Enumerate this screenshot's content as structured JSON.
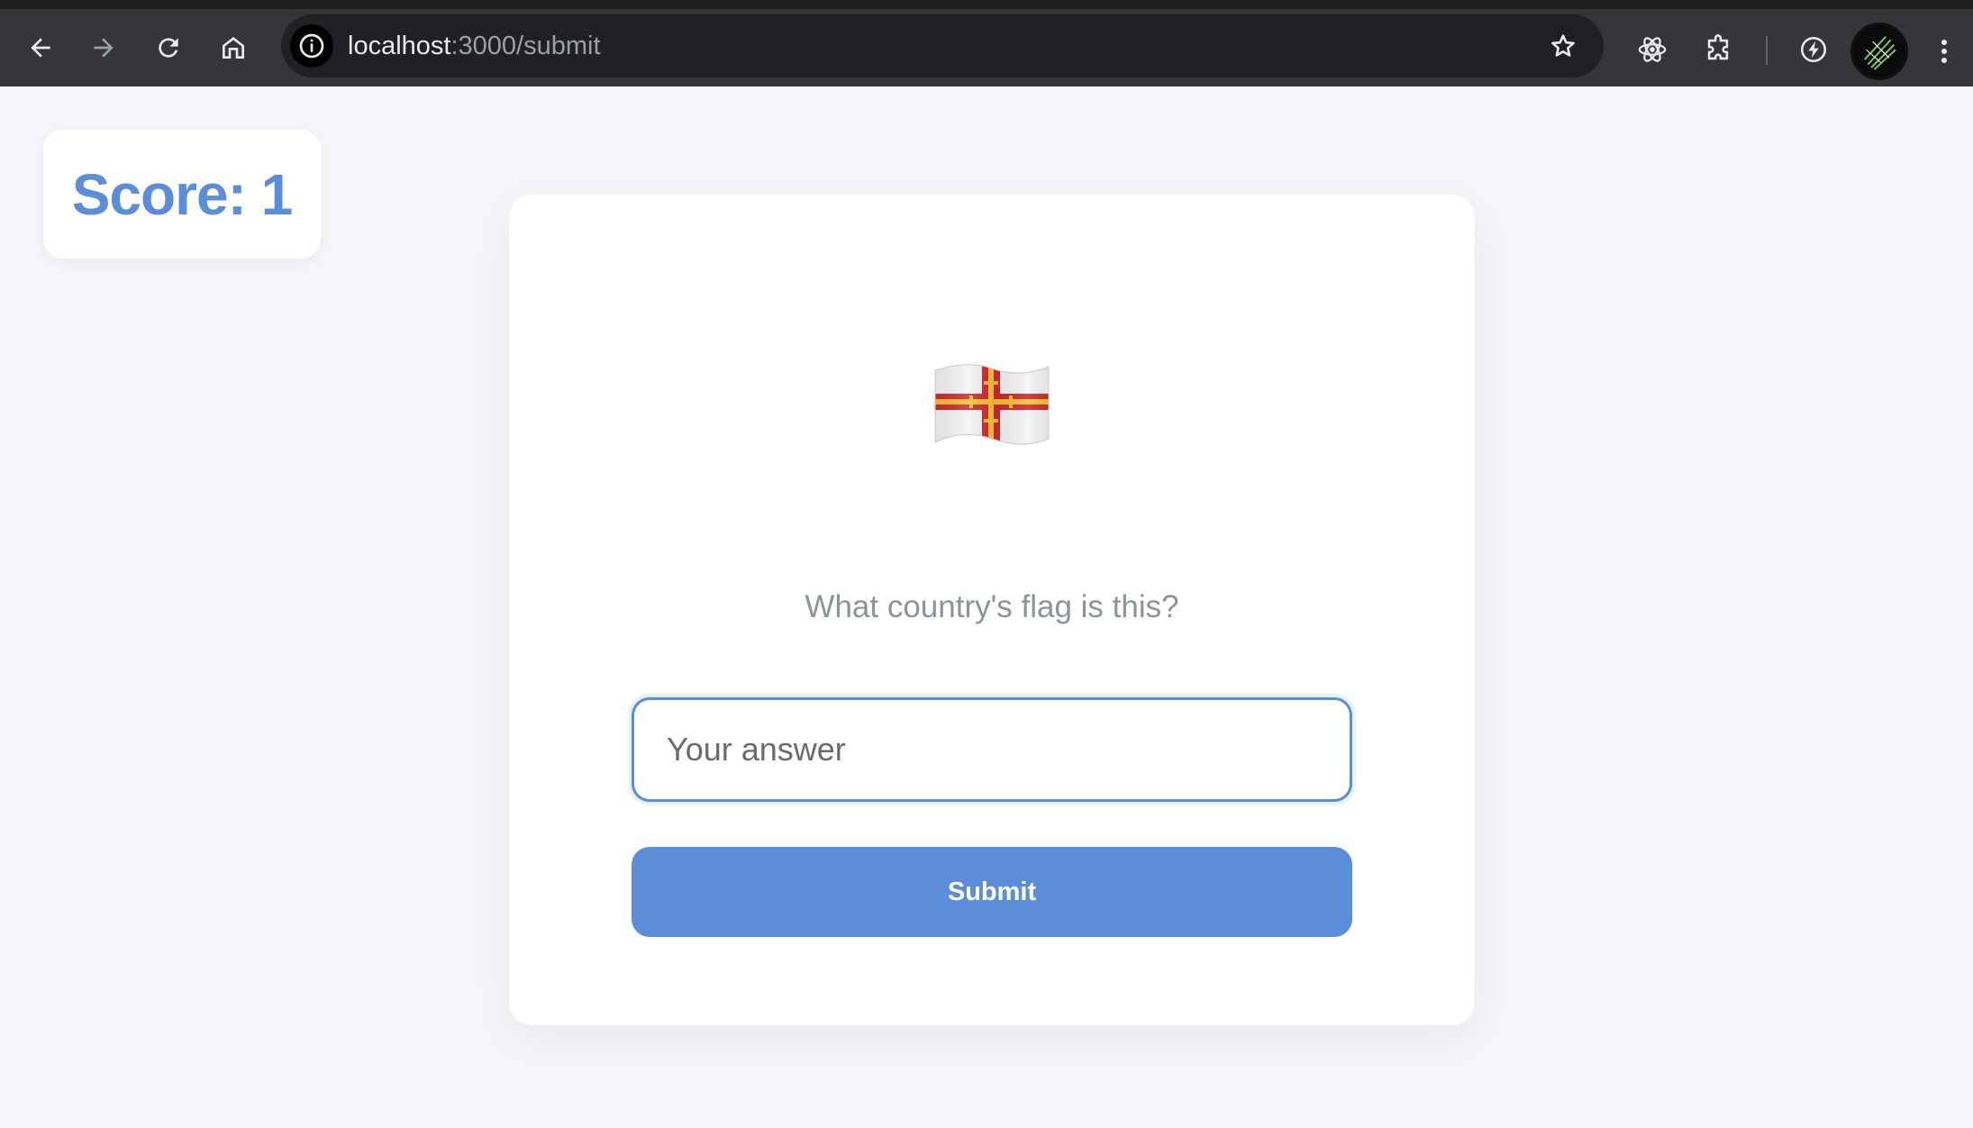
{
  "browser": {
    "url_host": "localhost",
    "url_path": ":3000/submit",
    "icons": {
      "back": "back-arrow-icon",
      "forward": "forward-arrow-icon",
      "reload": "reload-icon",
      "home": "home-icon",
      "site_info": "info-icon",
      "bookmark": "star-icon",
      "ext_react": "react-atom-icon",
      "ext_puzzle": "extensions-puzzle-icon",
      "ext_bolt": "lightning-bolt-icon",
      "menu": "kebab-menu-icon"
    }
  },
  "score": {
    "text": "Score: 1"
  },
  "quiz": {
    "flag_emoji_name": "flag-guernsey-icon",
    "question": "What country's flag is this?",
    "answer_placeholder": "Your answer",
    "answer_value": "",
    "submit_label": "Submit"
  },
  "colors": {
    "chrome_bg": "#35363a",
    "omnibox_bg": "#202124",
    "page_bg": "#f5f6fa",
    "accent": "#5b8dd9",
    "question_text": "#8a9499"
  }
}
